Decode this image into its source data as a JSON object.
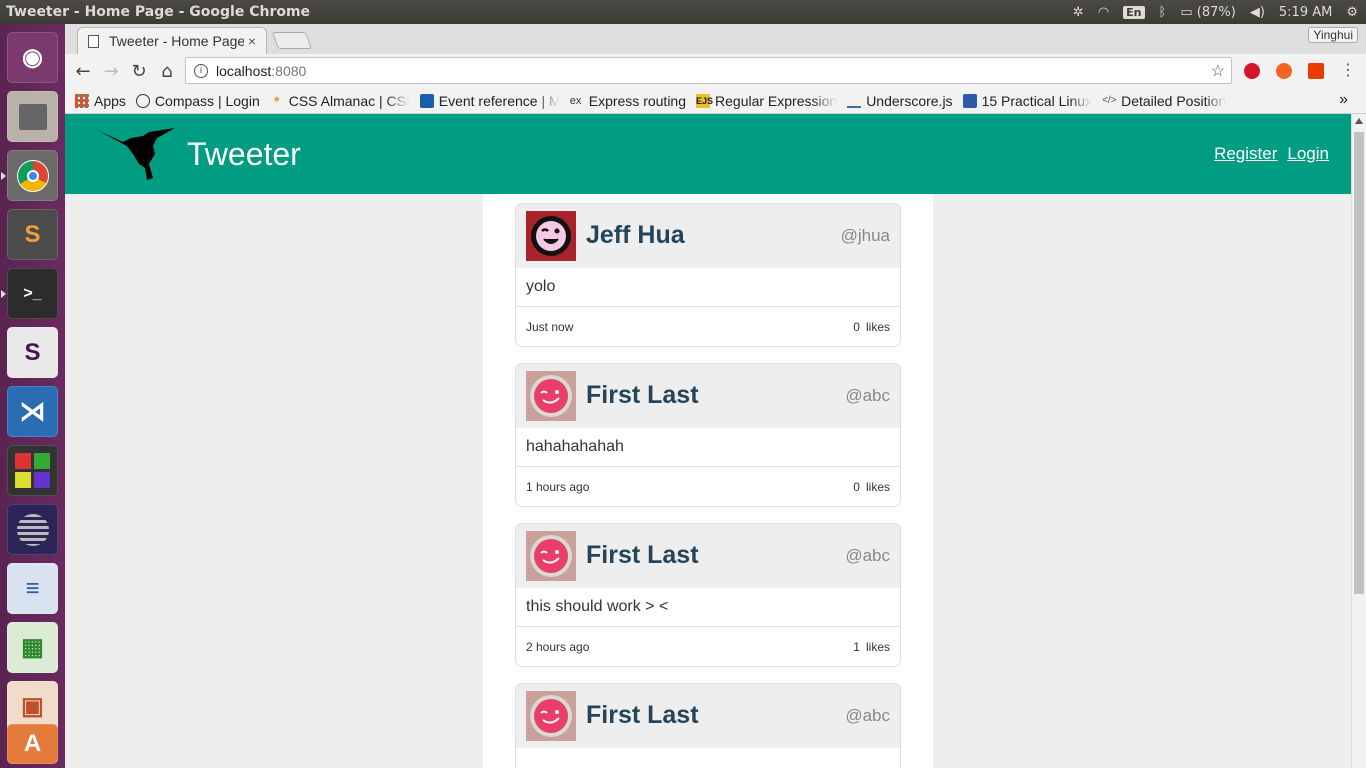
{
  "topbar": {
    "window_title": "Tweeter - Home Page - Google Chrome",
    "keyboard_layout": "En",
    "battery": "(87%)",
    "clock": "5:19 AM",
    "icons": [
      "network-settings-icon",
      "wifi-icon",
      "keyboard-icon",
      "bluetooth-icon",
      "battery-icon",
      "volume-icon",
      "power-gear-icon"
    ]
  },
  "launcher": {
    "items": [
      "ubuntu-dash",
      "files",
      "chrome",
      "sublime-text",
      "terminal",
      "slack",
      "vscode",
      "app-grid",
      "eclipse",
      "libreoffice-draw",
      "libreoffice-calc",
      "libreoffice-impress",
      "software-center"
    ]
  },
  "browser": {
    "tab_title": "Tweeter - Home Page",
    "tab_close": "×",
    "profile_name": "Yinghui",
    "url_host": "localhost",
    "url_port": ":8080",
    "bookmarks": [
      {
        "label": "Apps",
        "icon": "apps-grid-icon"
      },
      {
        "label": "Compass | Login",
        "icon": "compass-icon"
      },
      {
        "label": "CSS Almanac | CSS-",
        "icon": "css-tricks-icon"
      },
      {
        "label": "Event reference | M",
        "icon": "mdn-icon"
      },
      {
        "label": "Express routing",
        "icon": "express-icon"
      },
      {
        "label": "Regular Expression",
        "icon": "ejs-icon"
      },
      {
        "label": "Underscore.js",
        "icon": "underscore-icon"
      },
      {
        "label": "15 Practical Linux",
        "icon": "tecmint-icon"
      },
      {
        "label": "Detailed Position",
        "icon": "code-icon"
      }
    ],
    "bookmark_overflow": "»"
  },
  "site": {
    "brand": "Tweeter",
    "nav": {
      "register": "Register",
      "login": "Login"
    },
    "colors": {
      "header": "#009d82",
      "name": "#244559"
    }
  },
  "tweets": [
    {
      "name": "Jeff Hua",
      "handle": "@jhua",
      "text": "yolo",
      "time": "Just now",
      "likes": "0",
      "likes_label": "likes",
      "avatar": "dark-winking-face-avatar"
    },
    {
      "name": "First Last",
      "handle": "@abc",
      "text": "hahahahahah",
      "time": "1 hours ago",
      "likes": "0",
      "likes_label": "likes",
      "avatar": "pink-winking-face-avatar"
    },
    {
      "name": "First Last",
      "handle": "@abc",
      "text": "this should work > <",
      "time": "2 hours ago",
      "likes": "1",
      "likes_label": "likes",
      "avatar": "pink-winking-face-avatar"
    },
    {
      "name": "First Last",
      "handle": "@abc",
      "text": "",
      "time": "",
      "likes": "",
      "likes_label": "",
      "avatar": "pink-winking-face-avatar"
    }
  ]
}
